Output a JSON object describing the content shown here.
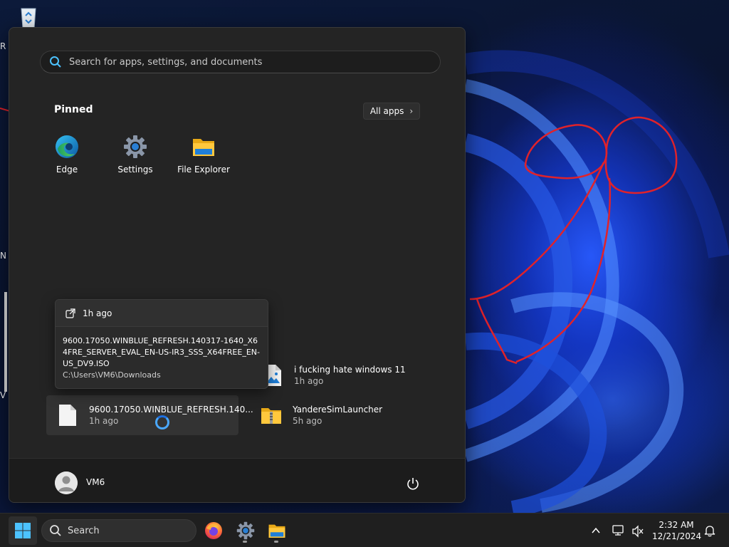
{
  "desktop": {
    "edge_labels": [
      "R",
      "N",
      "V"
    ]
  },
  "start_menu": {
    "search_placeholder": "Search for apps, settings, and documents",
    "pinned_title": "Pinned",
    "all_apps_label": "All apps",
    "pinned_apps": [
      {
        "label": "Edge",
        "icon": "edge-icon"
      },
      {
        "label": "Settings",
        "icon": "settings-icon"
      },
      {
        "label": "File Explorer",
        "icon": "file-explorer-icon"
      }
    ],
    "tooltip": {
      "time": "1h ago",
      "filename": "9600.17050.WINBLUE_REFRESH.140317-1640_X64FRE_SERVER_EVAL_EN-US-IR3_SSS_X64FREE_EN-US_DV9.ISO",
      "path": "C:\\Users\\VM6\\Downloads"
    },
    "recommended": [
      {
        "name": "9600.17050.WINBLUE_REFRESH.140...",
        "time": "1h ago",
        "icon": "file-icon"
      },
      {
        "name": "i fucking hate windows 11",
        "time": "1h ago",
        "icon": "image-file-icon"
      },
      {
        "name": "YandereSimLauncher",
        "time": "5h ago",
        "icon": "zip-folder-icon"
      }
    ],
    "user_name": "VM6"
  },
  "taskbar": {
    "search_label": "Search",
    "time": "2:32 AM",
    "date": "12/21/2024"
  },
  "colors": {
    "accent": "#1d6fe0",
    "menu_bg": "#242424",
    "annotation": "#e0222a"
  }
}
